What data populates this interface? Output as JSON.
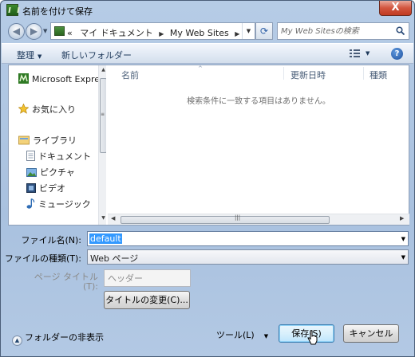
{
  "window": {
    "title": "名前を付けて保存",
    "close_label": "X"
  },
  "address_bar": {
    "prefix": "«",
    "crumbs": [
      "マイ ドキュメント",
      "My Web Sites"
    ],
    "search_placeholder": "My Web Sitesの検索"
  },
  "toolbar": {
    "organize_label": "整理",
    "new_folder_label": "新しいフォルダー",
    "help_label": "?"
  },
  "nav_pane": {
    "items": [
      {
        "label": "Microsoft Express",
        "icon": "express-app-icon"
      },
      {
        "label": "お気に入り",
        "icon": "star-icon"
      },
      {
        "label": "ライブラリ",
        "icon": "library-icon"
      },
      {
        "label": "ドキュメント",
        "icon": "document-icon"
      },
      {
        "label": "ピクチャ",
        "icon": "picture-icon"
      },
      {
        "label": "ビデオ",
        "icon": "video-icon"
      },
      {
        "label": "ミュージック",
        "icon": "music-icon"
      }
    ]
  },
  "file_list": {
    "columns": [
      "名前",
      "更新日時",
      "種類"
    ],
    "empty_message": "検索条件に一致する項目はありません。"
  },
  "form": {
    "filename_label": "ファイル名(N):",
    "filename_value": "default",
    "filetype_label": "ファイルの種類(T):",
    "filetype_value": "Web ページ",
    "page_title_label_1": "ページ タイトル",
    "page_title_label_2": "(T):",
    "page_title_placeholder": "ヘッダー",
    "change_title_button": "タイトルの変更(C)..."
  },
  "footer": {
    "hide_folders_label": "フォルダーの非表示",
    "tools_label": "ツール(L)",
    "save_button": "保存(S)",
    "cancel_button": "キャンセル"
  },
  "colors": {
    "accent": "#3399ff",
    "close_button": "#c03b22",
    "frame": "#b6cce6"
  }
}
